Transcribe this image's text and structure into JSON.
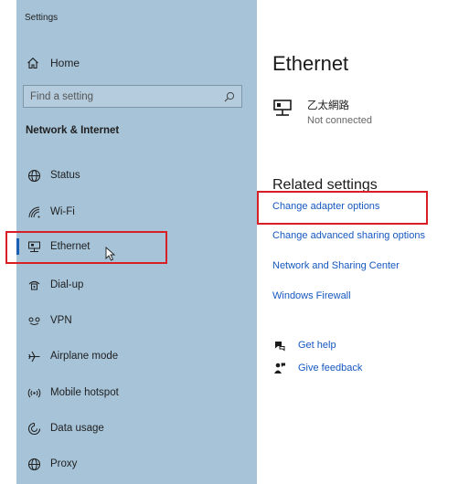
{
  "window": {
    "title": "Settings"
  },
  "sidebar": {
    "home_label": "Home",
    "search_placeholder": "Find a setting",
    "section_header": "Network & Internet",
    "items": [
      {
        "label": "Status",
        "icon": "status-globe-icon"
      },
      {
        "label": "Wi-Fi",
        "icon": "wifi-icon"
      },
      {
        "label": "Ethernet",
        "icon": "ethernet-icon",
        "selected": true
      },
      {
        "label": "Dial-up",
        "icon": "dialup-icon"
      },
      {
        "label": "VPN",
        "icon": "vpn-icon"
      },
      {
        "label": "Airplane mode",
        "icon": "airplane-icon"
      },
      {
        "label": "Mobile hotspot",
        "icon": "hotspot-icon"
      },
      {
        "label": "Data usage",
        "icon": "data-usage-icon"
      },
      {
        "label": "Proxy",
        "icon": "proxy-globe-icon"
      }
    ]
  },
  "main": {
    "title": "Ethernet",
    "adapter": {
      "name": "乙太網路",
      "status": "Not connected"
    },
    "related_header": "Related settings",
    "links": [
      "Change adapter options",
      "Change advanced sharing options",
      "Network and Sharing Center",
      "Windows Firewall"
    ],
    "help": {
      "get_help": "Get help",
      "give_feedback": "Give feedback"
    }
  },
  "colors": {
    "sidebar_bg": "#a6c3d8",
    "link": "#1557c0",
    "highlight_box": "#d91f26",
    "accent": "#1a5fb4"
  }
}
